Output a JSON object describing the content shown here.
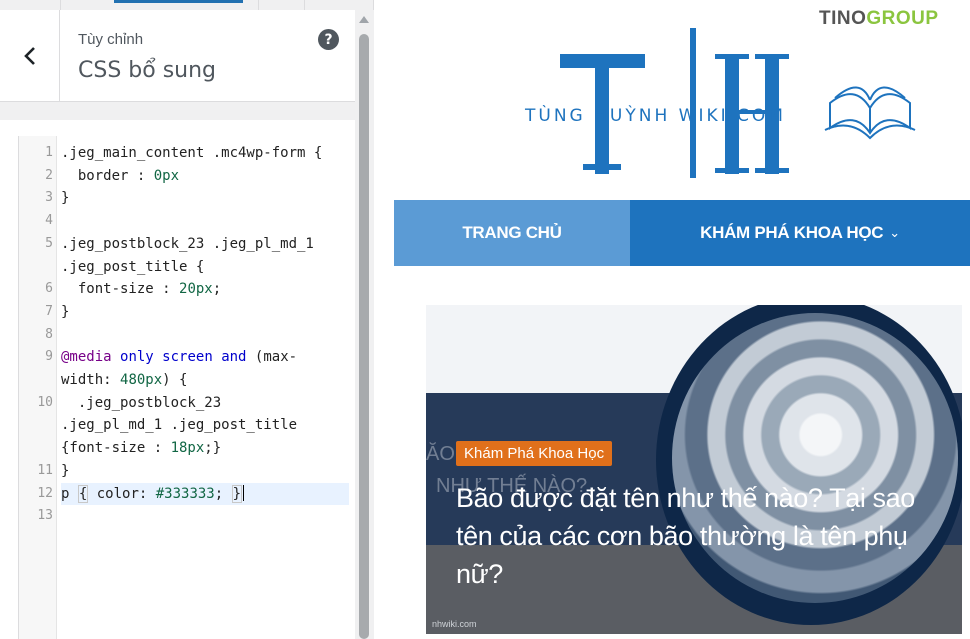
{
  "customizer": {
    "breadcrumb": "Tùy chỉnh",
    "section_title": "CSS bổ sung",
    "help_label": "?",
    "code_lines": [
      {
        "num": "1",
        "text": ".jeg_main_content .mc4wp-form {"
      },
      {
        "num": "2",
        "text": "  border : 0px"
      },
      {
        "num": "3",
        "text": "}"
      },
      {
        "num": "4",
        "text": ""
      },
      {
        "num": "5",
        "text": ".jeg_postblock_23 .jeg_pl_md_1"
      },
      {
        "num": "",
        "text": ".jeg_post_title {"
      },
      {
        "num": "6",
        "text": "  font-size : 20px;"
      },
      {
        "num": "7",
        "text": "}"
      },
      {
        "num": "8",
        "text": ""
      },
      {
        "num": "9",
        "text": "@media only screen and (max-"
      },
      {
        "num": "",
        "text": "width: 480px) {"
      },
      {
        "num": "10",
        "text": "  .jeg_postblock_23"
      },
      {
        "num": "",
        "text": ".jeg_pl_md_1 .jeg_post_title"
      },
      {
        "num": "",
        "text": "{font-size : 18px;}"
      },
      {
        "num": "11",
        "text": "}"
      },
      {
        "num": "12",
        "text": "p { color: #333333; }"
      },
      {
        "num": "13",
        "text": ""
      }
    ]
  },
  "preview": {
    "brand_a": "TINO",
    "brand_b": "GROUP",
    "logo_text": "TÙNG HUỲNH WIKI.COM",
    "nav": {
      "home": "TRANG CHỦ",
      "explore": "KHÁM PHÁ KHOA HỌC",
      "explore_chevron": "⌄"
    },
    "post": {
      "category": "Khám Phá Khoa Học",
      "title": "Bão được đặt tên như thế nào? Tại sao tên của các cơn bão thường là tên phụ nữ?",
      "ghost_1": "ĂO",
      "ghost_2": "NHƯ THẾ NÀO?",
      "credit": "nhwiki.com"
    }
  },
  "colors": {
    "accent": "#2271b1",
    "nav_light": "#5b9bd5",
    "nav_dark": "#1e73be",
    "category_badge": "#e0701b"
  }
}
